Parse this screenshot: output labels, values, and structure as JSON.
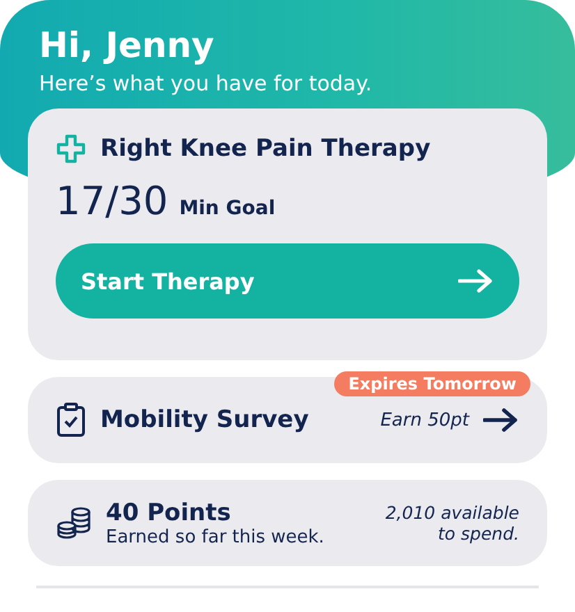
{
  "greeting": {
    "title": "Hi, Jenny",
    "subtitle": "Here’s what you have for today."
  },
  "therapy": {
    "title": "Right Knee Pain Therapy",
    "progress": "17/30",
    "progress_label": "Min Goal",
    "button": "Start Therapy"
  },
  "survey": {
    "badge": "Expires Tomorrow",
    "title": "Mobility Survey",
    "reward": "Earn 50pt"
  },
  "points": {
    "title": "40 Points",
    "subtitle": "Earned so far this week.",
    "available": "2,010 available to spend."
  }
}
